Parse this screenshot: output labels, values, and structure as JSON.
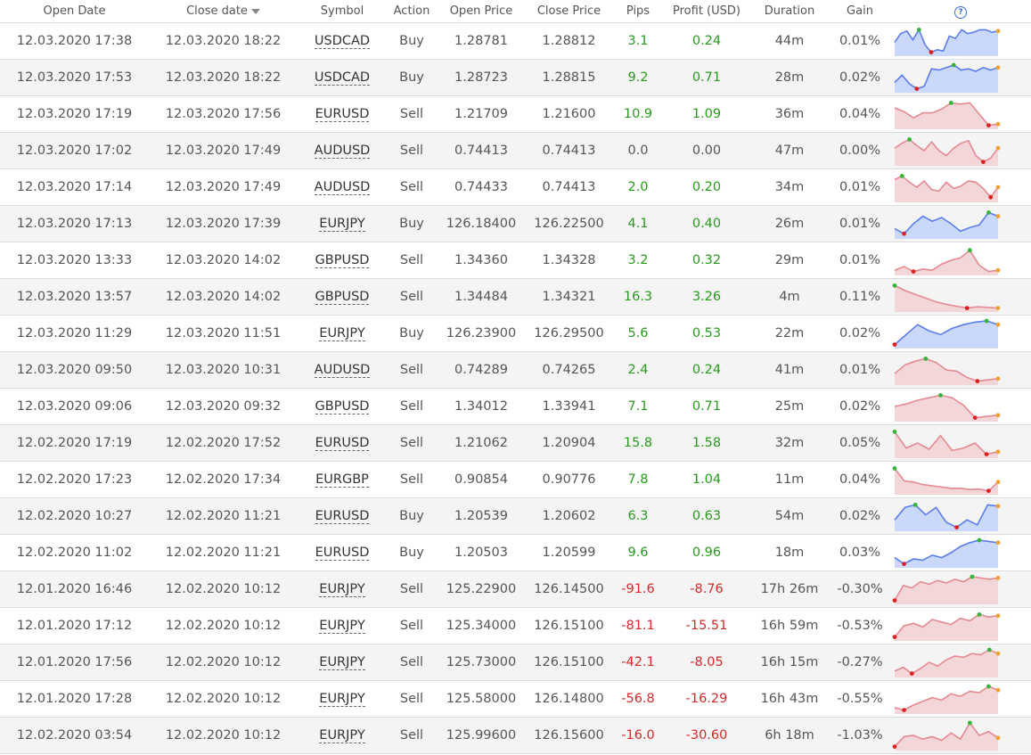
{
  "headers": {
    "open_date": "Open Date",
    "close_date": "Close date",
    "symbol": "Symbol",
    "action": "Action",
    "open_price": "Open Price",
    "close_price": "Close Price",
    "pips": "Pips",
    "profit": "Profit (USD)",
    "duration": "Duration",
    "gain": "Gain",
    "help_glyph": "?"
  },
  "colors": {
    "positive": "#2a9a1f",
    "negative": "#d42a2a",
    "buy_fill": "#c9d8fb",
    "buy_line": "#5c7df0",
    "sell_fill": "#f2d6d8",
    "sell_line": "#e58a90",
    "marker_high": "#34b53a",
    "marker_low": "#e02020",
    "marker_end": "#f0a030"
  },
  "trades": [
    {
      "open_date": "12.03.2020 17:38",
      "close_date": "12.03.2020 18:22",
      "symbol": "USDCAD",
      "action": "Buy",
      "open_price": "1.28781",
      "close_price": "1.28812",
      "pips": "3.1",
      "profit": "0.24",
      "duration": "44m",
      "gain": "0.01%",
      "spark": [
        0.45,
        0.8,
        0.9,
        0.55,
        0.95,
        0.35,
        0.05,
        0.15,
        0.1,
        0.7,
        0.6,
        0.95,
        0.8,
        0.85,
        0.95,
        0.95,
        0.85,
        0.9
      ]
    },
    {
      "open_date": "12.03.2020 17:53",
      "close_date": "12.03.2020 18:22",
      "symbol": "USDCAD",
      "action": "Buy",
      "open_price": "1.28723",
      "close_price": "1.28815",
      "pips": "9.2",
      "profit": "0.71",
      "duration": "28m",
      "gain": "0.02%",
      "spark": [
        0.3,
        0.6,
        0.25,
        0.05,
        0.15,
        0.85,
        0.8,
        0.9,
        1.0,
        0.8,
        0.85,
        0.75,
        0.9,
        0.8,
        0.9
      ]
    },
    {
      "open_date": "12.03.2020 17:19",
      "close_date": "12.03.2020 17:56",
      "symbol": "EURUSD",
      "action": "Sell",
      "open_price": "1.21709",
      "close_price": "1.21600",
      "pips": "10.9",
      "profit": "1.09",
      "duration": "36m",
      "gain": "0.04%",
      "spark": [
        0.75,
        0.6,
        0.35,
        0.55,
        0.55,
        0.7,
        0.95,
        0.9,
        0.95,
        0.5,
        0.05,
        0.1
      ]
    },
    {
      "open_date": "12.03.2020 17:02",
      "close_date": "12.03.2020 17:49",
      "symbol": "AUDUSD",
      "action": "Sell",
      "open_price": "0.74413",
      "close_price": "0.74413",
      "pips": "0.0",
      "profit": "0.00",
      "duration": "47m",
      "gain": "0.00%",
      "spark": [
        0.6,
        0.8,
        0.95,
        0.7,
        0.5,
        0.85,
        0.5,
        0.3,
        0.6,
        0.8,
        0.9,
        0.3,
        0.05,
        0.2,
        0.6
      ]
    },
    {
      "open_date": "12.03.2020 17:14",
      "close_date": "12.03.2020 17:49",
      "symbol": "AUDUSD",
      "action": "Sell",
      "open_price": "0.74433",
      "close_price": "0.74413",
      "pips": "2.0",
      "profit": "0.20",
      "duration": "34m",
      "gain": "0.01%",
      "spark": [
        0.8,
        0.95,
        0.7,
        0.5,
        0.75,
        0.4,
        0.35,
        0.7,
        0.45,
        0.55,
        0.75,
        0.7,
        0.45,
        0.1,
        0.5
      ]
    },
    {
      "open_date": "12.03.2020 17:13",
      "close_date": "12.03.2020 17:39",
      "symbol": "EURJPY",
      "action": "Buy",
      "open_price": "126.18400",
      "close_price": "126.22500",
      "pips": "4.1",
      "profit": "0.40",
      "duration": "26m",
      "gain": "0.01%",
      "spark": [
        0.3,
        0.1,
        0.5,
        0.8,
        0.6,
        0.75,
        0.5,
        0.2,
        0.35,
        0.45,
        0.95,
        0.8
      ]
    },
    {
      "open_date": "12.03.2020 13:33",
      "close_date": "12.03.2020 14:02",
      "symbol": "GBPUSD",
      "action": "Sell",
      "open_price": "1.34360",
      "close_price": "1.34328",
      "pips": "3.2",
      "profit": "0.32",
      "duration": "29m",
      "gain": "0.01%",
      "spark": [
        0.1,
        0.25,
        0.05,
        0.15,
        0.1,
        0.35,
        0.5,
        0.6,
        0.9,
        0.3,
        0.05,
        0.1
      ]
    },
    {
      "open_date": "12.03.2020 13:57",
      "close_date": "12.03.2020 14:02",
      "symbol": "GBPUSD",
      "action": "Sell",
      "open_price": "1.34484",
      "close_price": "1.34321",
      "pips": "16.3",
      "profit": "3.26",
      "duration": "4m",
      "gain": "0.11%",
      "spark": [
        0.95,
        0.75,
        0.6,
        0.45,
        0.3,
        0.2,
        0.12,
        0.05,
        0.1,
        0.08,
        0.05
      ]
    },
    {
      "open_date": "12.03.2020 11:29",
      "close_date": "12.03.2020 11:51",
      "symbol": "EURJPY",
      "action": "Buy",
      "open_price": "126.23900",
      "close_price": "126.29500",
      "pips": "5.6",
      "profit": "0.53",
      "duration": "22m",
      "gain": "0.02%",
      "spark": [
        0.05,
        0.45,
        0.85,
        0.6,
        0.45,
        0.7,
        0.85,
        0.95,
        1.0,
        0.85
      ]
    },
    {
      "open_date": "12.03.2020 09:50",
      "close_date": "12.03.2020 10:31",
      "symbol": "AUDUSD",
      "action": "Sell",
      "open_price": "0.74289",
      "close_price": "0.74265",
      "pips": "2.4",
      "profit": "0.24",
      "duration": "41m",
      "gain": "0.01%",
      "spark": [
        0.35,
        0.7,
        0.85,
        0.95,
        0.8,
        0.5,
        0.45,
        0.2,
        0.05,
        0.1,
        0.15
      ]
    },
    {
      "open_date": "12.03.2020 09:06",
      "close_date": "12.03.2020 09:32",
      "symbol": "GBPUSD",
      "action": "Sell",
      "open_price": "1.34012",
      "close_price": "1.33941",
      "pips": "7.1",
      "profit": "0.71",
      "duration": "25m",
      "gain": "0.02%",
      "spark": [
        0.5,
        0.6,
        0.75,
        0.85,
        0.95,
        0.85,
        0.55,
        0.05,
        0.1,
        0.15
      ]
    },
    {
      "open_date": "12.02.2020 17:19",
      "close_date": "12.02.2020 17:52",
      "symbol": "EURUSD",
      "action": "Sell",
      "open_price": "1.21062",
      "close_price": "1.20904",
      "pips": "15.8",
      "profit": "1.58",
      "duration": "32m",
      "gain": "0.05%",
      "spark": [
        0.95,
        0.3,
        0.5,
        0.25,
        0.8,
        0.2,
        0.3,
        0.5,
        0.05,
        0.15
      ]
    },
    {
      "open_date": "12.02.2020 17:23",
      "close_date": "12.02.2020 17:34",
      "symbol": "EURGBP",
      "action": "Sell",
      "open_price": "0.90854",
      "close_price": "0.90776",
      "pips": "7.8",
      "profit": "1.04",
      "duration": "11m",
      "gain": "0.04%",
      "spark": [
        0.95,
        0.45,
        0.4,
        0.3,
        0.25,
        0.2,
        0.15,
        0.15,
        0.1,
        0.12,
        0.05,
        0.4
      ]
    },
    {
      "open_date": "12.02.2020 10:27",
      "close_date": "12.02.2020 11:21",
      "symbol": "EURUSD",
      "action": "Buy",
      "open_price": "1.20539",
      "close_price": "1.20602",
      "pips": "6.3",
      "profit": "0.63",
      "duration": "54m",
      "gain": "0.02%",
      "spark": [
        0.35,
        0.85,
        0.95,
        0.55,
        0.85,
        0.25,
        0.05,
        0.35,
        0.15,
        0.95,
        0.9
      ]
    },
    {
      "open_date": "12.02.2020 11:02",
      "close_date": "12.02.2020 11:21",
      "symbol": "EURUSD",
      "action": "Buy",
      "open_price": "1.20503",
      "close_price": "1.20599",
      "pips": "9.6",
      "profit": "0.96",
      "duration": "18m",
      "gain": "0.03%",
      "spark": [
        0.3,
        0.05,
        0.25,
        0.2,
        0.4,
        0.3,
        0.5,
        0.75,
        0.9,
        1.0,
        0.95,
        0.9
      ]
    },
    {
      "open_date": "12.01.2020 16:46",
      "close_date": "12.02.2020 10:12",
      "symbol": "EURJPY",
      "action": "Sell",
      "open_price": "125.22900",
      "close_price": "126.14500",
      "pips": "-91.6",
      "profit": "-8.76",
      "duration": "17h 26m",
      "gain": "-0.30%",
      "spark": [
        0.05,
        0.65,
        0.55,
        0.8,
        0.7,
        0.85,
        0.75,
        0.9,
        0.8,
        1.0,
        0.95,
        0.9,
        0.95
      ]
    },
    {
      "open_date": "12.01.2020 17:12",
      "close_date": "12.02.2020 10:12",
      "symbol": "EURJPY",
      "action": "Sell",
      "open_price": "125.34000",
      "close_price": "126.15100",
      "pips": "-81.1",
      "profit": "-15.51",
      "duration": "16h 59m",
      "gain": "-0.53%",
      "spark": [
        0.05,
        0.5,
        0.6,
        0.45,
        0.75,
        0.65,
        0.55,
        0.8,
        0.7,
        0.95,
        0.85,
        0.9
      ]
    },
    {
      "open_date": "12.01.2020 17:56",
      "close_date": "12.02.2020 10:12",
      "symbol": "EURJPY",
      "action": "Sell",
      "open_price": "125.73000",
      "close_price": "126.15100",
      "pips": "-42.1",
      "profit": "-8.05",
      "duration": "16h 15m",
      "gain": "-0.27%",
      "spark": [
        0.15,
        0.3,
        0.05,
        0.25,
        0.5,
        0.35,
        0.6,
        0.75,
        0.7,
        0.85,
        0.8,
        1.0,
        0.85
      ]
    },
    {
      "open_date": "12.01.2020 17:28",
      "close_date": "12.02.2020 10:12",
      "symbol": "EURJPY",
      "action": "Sell",
      "open_price": "125.58000",
      "close_price": "126.14800",
      "pips": "-56.8",
      "profit": "-16.29",
      "duration": "16h 43m",
      "gain": "-0.55%",
      "spark": [
        0.15,
        0.05,
        0.25,
        0.4,
        0.55,
        0.45,
        0.7,
        0.6,
        0.8,
        0.75,
        1.0,
        0.85
      ]
    },
    {
      "open_date": "12.02.2020 03:54",
      "close_date": "12.02.2020 10:12",
      "symbol": "EURJPY",
      "action": "Sell",
      "open_price": "125.99600",
      "close_price": "126.15600",
      "pips": "-16.0",
      "profit": "-30.60",
      "duration": "6h 18m",
      "gain": "-1.03%",
      "spark": [
        0.05,
        0.45,
        0.5,
        0.35,
        0.45,
        0.3,
        0.6,
        0.35,
        1.0,
        0.5,
        0.65,
        0.4
      ]
    }
  ]
}
